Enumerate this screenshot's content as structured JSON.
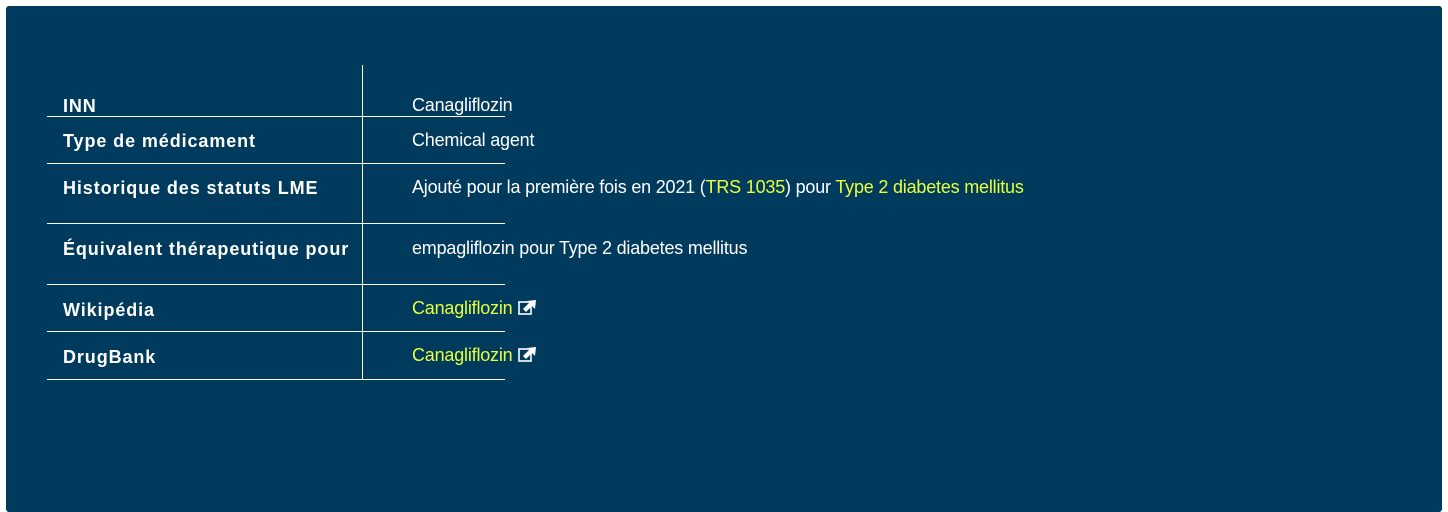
{
  "rows": {
    "inn": {
      "label": "INN",
      "value": "Canagliflozin"
    },
    "type": {
      "label": "Type de médicament",
      "value": "Chemical agent"
    },
    "history": {
      "label": "Historique des statuts LME",
      "text_before": "Ajouté pour la première fois en 2021 (",
      "trs_link": "TRS 1035",
      "text_middle": ") pour ",
      "indication_link": "Type 2 diabetes mellitus"
    },
    "equivalent": {
      "label": "Équivalent thérapeutique pour",
      "value": "empagliflozin pour Type 2 diabetes mellitus"
    },
    "wikipedia": {
      "label": "Wikipédia",
      "link": "Canagliflozin",
      "icon": "external-link-icon"
    },
    "drugbank": {
      "label": "DrugBank",
      "link": "Canagliflozin",
      "icon": "external-link-icon"
    }
  },
  "colors": {
    "panel_background": "#003a5d",
    "text": "#ffffff",
    "link": "#e8ff3c"
  }
}
